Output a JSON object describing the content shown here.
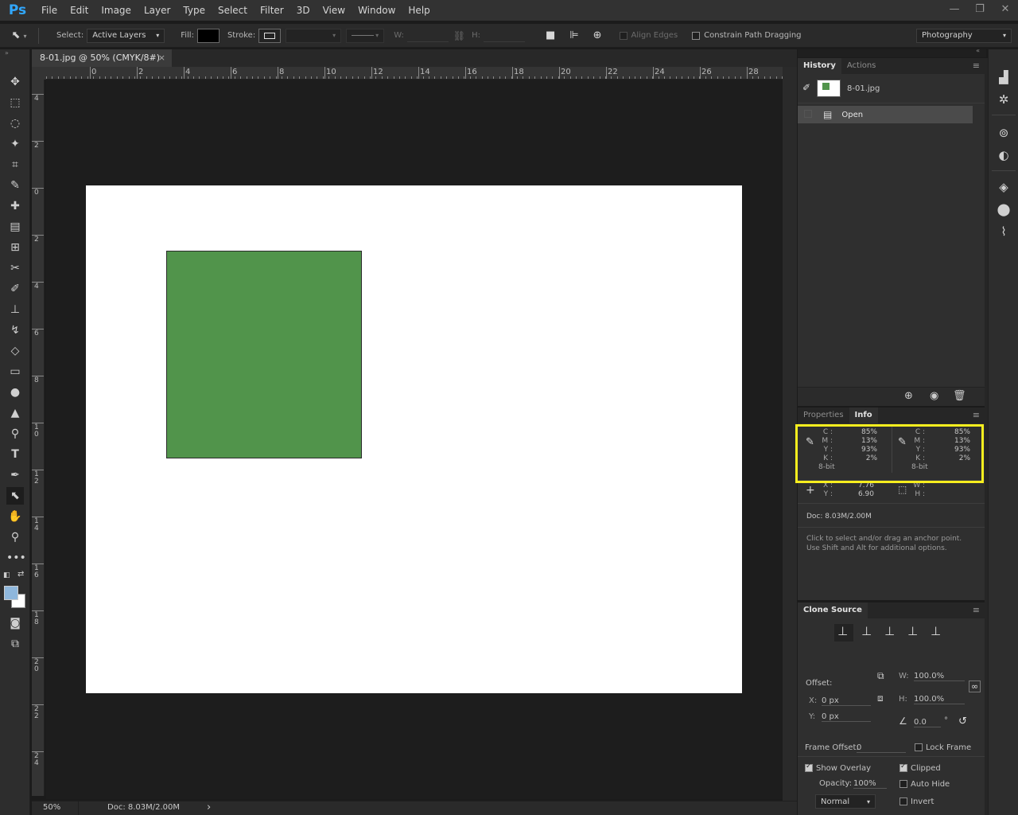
{
  "app": {
    "logo": "Ps",
    "menu": [
      "File",
      "Edit",
      "Image",
      "Layer",
      "Type",
      "Select",
      "Filter",
      "3D",
      "View",
      "Window",
      "Help"
    ],
    "window_controls": [
      "—",
      "❐",
      "✕"
    ]
  },
  "options_bar": {
    "select_label": "Select:",
    "select_value": "Active Layers",
    "fill_label": "Fill:",
    "stroke_label": "Stroke:",
    "w_label": "W:",
    "h_label": "H:",
    "align_edges": "Align Edges",
    "constrain_path": "Constrain Path Dragging",
    "workspace": "Photography"
  },
  "document": {
    "tab_title": "8-01.jpg @ 50% (CMYK/8#)",
    "close": "×",
    "fill_color": "#51944b"
  },
  "rulers": {
    "h_labels": [
      "0",
      "2",
      "4",
      "6",
      "8",
      "10",
      "12",
      "14",
      "16",
      "18",
      "20",
      "22",
      "24",
      "26",
      "28"
    ],
    "v_labels": [
      "4",
      "2",
      "0",
      "2",
      "4",
      "6",
      "8",
      "10",
      "12",
      "14",
      "16",
      "18",
      "20",
      "22",
      "24"
    ]
  },
  "status": {
    "zoom": "50%",
    "doc": "Doc: 8.03M/2.00M",
    "arrow": "›"
  },
  "history": {
    "tabs": [
      "History",
      "Actions"
    ],
    "snapshot": "8-01.jpg",
    "steps": [
      "Open"
    ]
  },
  "info": {
    "tabs": [
      "Properties",
      "Info"
    ],
    "cmyk_labels": [
      "C :",
      "M :",
      "Y :",
      "K :"
    ],
    "left_values": [
      "85%",
      "13%",
      "93%",
      "2%"
    ],
    "right_values": [
      "85%",
      "13%",
      "93%",
      "2%"
    ],
    "bit_depth": "8-bit",
    "x_label": "X :",
    "y_label": "Y :",
    "x_value": "7.76",
    "y_value": "6.90",
    "w_label": "W :",
    "h_label": "H :",
    "doc": "Doc: 8.03M/2.00M",
    "hint_line1": "Click to select and/or drag an anchor point.",
    "hint_line2": "Use Shift and Alt for additional options.",
    "highlight_color": "#f7ee1e"
  },
  "clone_source": {
    "title": "Clone Source",
    "offset_label": "Offset:",
    "x_label": "X:",
    "x_value": "0 px",
    "y_label": "Y:",
    "y_value": "0 px",
    "w_label": "W:",
    "w_value": "100.0%",
    "h_label": "H:",
    "h_value": "100.0%",
    "angle_value": "0.0",
    "degree": "°",
    "frame_offset_label": "Frame Offset:",
    "frame_offset_value": "0",
    "lock_frame": "Lock Frame",
    "show_overlay": "Show Overlay",
    "clipped": "Clipped",
    "opacity_label": "Opacity:",
    "opacity_value": "100%",
    "auto_hide": "Auto Hide",
    "blend_mode": "Normal",
    "invert": "Invert"
  }
}
